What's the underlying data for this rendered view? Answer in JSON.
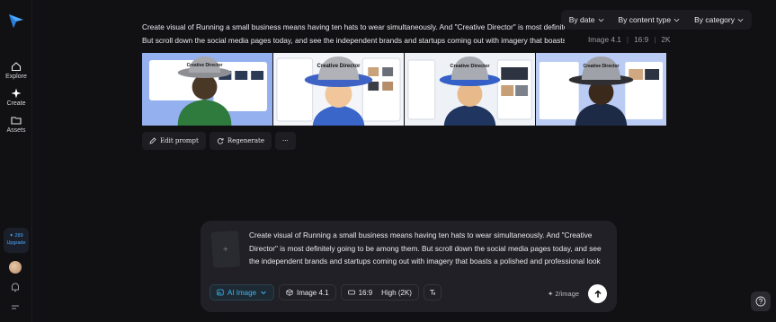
{
  "sidebar": {
    "items": [
      {
        "label": "Explore",
        "icon": "home-icon"
      },
      {
        "label": "Create",
        "icon": "sparkle-icon"
      },
      {
        "label": "Assets",
        "icon": "folder-icon"
      }
    ],
    "upgrade": {
      "credits": "✦ 289",
      "label": "Upgrade"
    }
  },
  "filters": [
    {
      "label": "By date"
    },
    {
      "label": "By content type"
    },
    {
      "label": "By category"
    }
  ],
  "generation": {
    "prompt_line1": "Create visual of Running a small business means having ten hats to wear simultaneously. And \"Creative Director\" is most definitely going to be among them.",
    "prompt_line2": "But scroll down the social media pages today, and see the independent brands and startups coming out with imagery that boasts a polished",
    "model": "Image 4.1",
    "ratio": "16:9",
    "resolution": "2K",
    "images": [
      {
        "hat_text": "Creative Director",
        "accent": "#3a6fe0"
      },
      {
        "hat_text": "Creative Director",
        "accent": "#3a6fe0"
      },
      {
        "hat_text": "Creative Director",
        "accent": "#3a6fe0"
      },
      {
        "hat_text": "Creative Director",
        "accent": "#3a6fe0"
      }
    ],
    "actions": {
      "edit": "Edit prompt",
      "regenerate": "Regenerate",
      "more": "···"
    }
  },
  "composer": {
    "text": "Create visual of Running a small business means having ten hats to wear simultaneously. And \"Creative Director\" is most definitely going to be among them. But scroll down the social media pages today, and see the independent brands and startups coming out with imagery that boasts a polished and professional look",
    "mode": "AI Image",
    "model": "Image 4.1",
    "ratio": "16:9",
    "quality": "High (2K)",
    "credit_cost": "✦ 2/image"
  },
  "colors": {
    "accent": "#3fb7f5",
    "background": "#111114",
    "panel": "#202026"
  }
}
